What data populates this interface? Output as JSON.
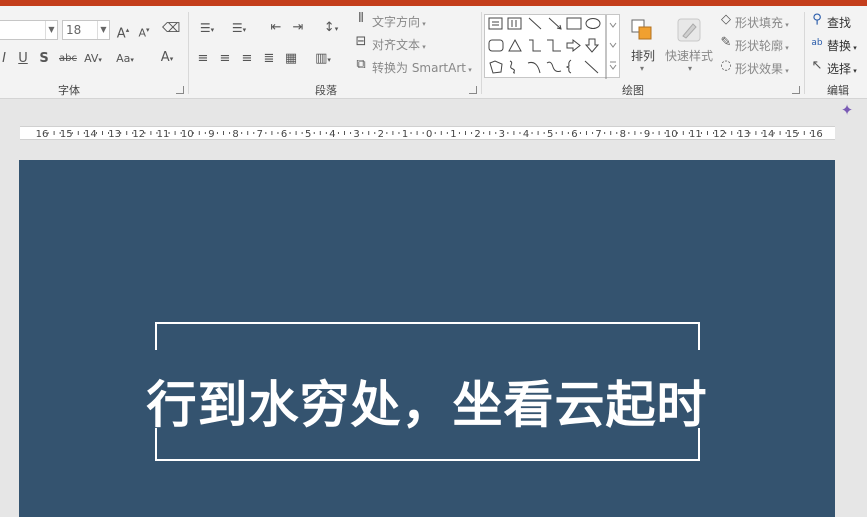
{
  "ribbon": {
    "font": {
      "label": "字体",
      "font_name": "",
      "font_size": "18",
      "buttons": [
        "grow-font",
        "shrink-font",
        "clear-format",
        "italic",
        "underline",
        "shadow",
        "strikethrough",
        "char-spacing",
        "change-case",
        "font-color"
      ]
    },
    "paragraph": {
      "label": "段落",
      "text_direction": "文字方向",
      "align_text": "对齐文本",
      "convert_smartart": "转换为 SmartArt"
    },
    "drawing": {
      "label": "绘图",
      "arrange": "排列",
      "quick_styles": "快速样式",
      "shape_fill": "形状填充",
      "shape_outline": "形状轮廓",
      "shape_effects": "形状效果"
    },
    "editing": {
      "label": "编辑",
      "find": "查找",
      "replace": "替换",
      "select": "选择"
    }
  },
  "ruler": {
    "labels": [
      "16",
      "15",
      "14",
      "13",
      "12",
      "11",
      "10",
      "9",
      "8",
      "7",
      "6",
      "5",
      "4",
      "3",
      "2",
      "1",
      "0",
      "1",
      "2",
      "3",
      "4",
      "5",
      "6",
      "7",
      "8",
      "9",
      "10",
      "11",
      "12",
      "13",
      "14",
      "15",
      "16"
    ]
  },
  "slide": {
    "title": "行到水穷处，坐看云起时",
    "background": "#34536f",
    "text_color": "#ffffff"
  },
  "colors": {
    "titlebar": "#c43e1c",
    "ribbon_bg": "#f3f3f3",
    "workspace": "#e6e6e6"
  }
}
